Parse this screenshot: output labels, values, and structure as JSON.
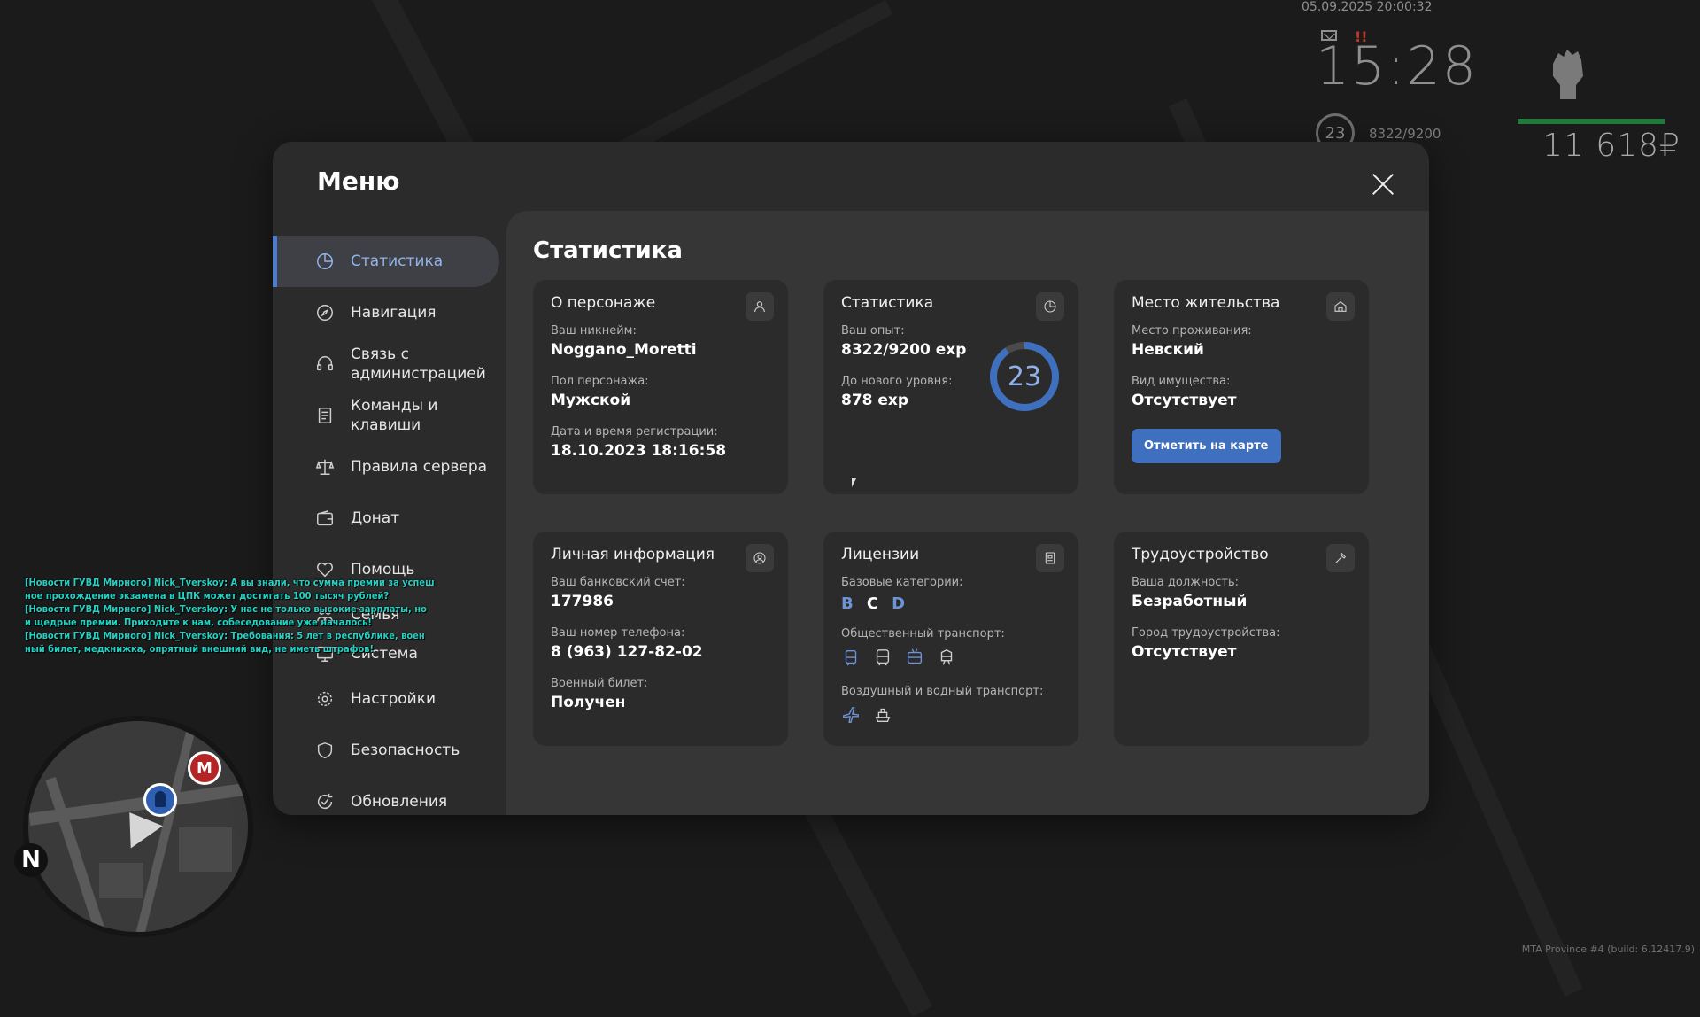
{
  "hud": {
    "datetime": "05.09.2025 20:00:32",
    "clock": "15:28",
    "alert": "!!",
    "level": "23",
    "exp": "8322/9200",
    "money": "11 618₽",
    "build": "MTA Province #4 (build: 6.12417.9)"
  },
  "chat": [
    "[Новости ГУВД Мирного] Nick_Tverskoy: А вы знали, что сумма премии за успеш",
    "ное прохождение экзамена в ЦПК может достигать 100 тысяч рублей?",
    "[Новости ГУВД Мирного] Nick_Tverskoy: У нас не только высокие зарплаты, но",
    " и щедрые премии. Приходите к нам, собеседование уже началось!",
    "[Новости ГУВД Мирного] Nick_Tverskoy: Требования: 5 лет в республике, воен",
    "ный билет, медкнижка, опрятный внешний вид, не иметь штрафов!"
  ],
  "minimap": {
    "north": "N",
    "metro": "М"
  },
  "menu": {
    "title": "Меню",
    "sidebar": [
      {
        "label": "Статистика",
        "icon": "pie-chart-icon",
        "active": true
      },
      {
        "label": "Навигация",
        "icon": "compass-icon"
      },
      {
        "label": "Связь с администрацией",
        "icon": "headset-icon"
      },
      {
        "label": "Команды и клавиши",
        "icon": "document-icon"
      },
      {
        "label": "Правила сервера",
        "icon": "scales-icon"
      },
      {
        "label": "Донат",
        "icon": "wallet-icon"
      },
      {
        "label": "Помощь",
        "icon": "heart-hand-icon"
      },
      {
        "label": "Семья",
        "icon": "family-icon"
      },
      {
        "label": "Система",
        "icon": "system-icon"
      },
      {
        "label": "Настройки",
        "icon": "gear-icon"
      },
      {
        "label": "Безопасность",
        "icon": "shield-icon"
      },
      {
        "label": "Обновления",
        "icon": "refresh-icon"
      }
    ],
    "content_title": "Статистика",
    "cards": {
      "character": {
        "title": "О персонаже",
        "nick_label": "Ваш никнейм:",
        "nick": "Noggano_Moretti",
        "gender_label": "Пол персонажа:",
        "gender": "Мужской",
        "reg_label": "Дата и время регистрации:",
        "reg": "18.10.2023 18:16:58"
      },
      "stats": {
        "title": "Статистика",
        "exp_label": "Ваш опыт:",
        "exp": "8322/9200 exp",
        "next_label": "До нового уровня:",
        "next": "878 exp",
        "level": "23",
        "progress": 0.905
      },
      "residence": {
        "title": "Место жительства",
        "place_label": "Место проживания:",
        "place": "Невский",
        "property_label": "Вид имущества:",
        "property": "Отсутствует",
        "button": "Отметить на карте"
      },
      "personal": {
        "title": "Личная информация",
        "bank_label": "Ваш банковский счет:",
        "bank": "177986",
        "phone_label": "Ваш номер телефона:",
        "phone": "8 (963) 127-82-02",
        "military_label": "Военный билет:",
        "military": "Получен"
      },
      "licenses": {
        "title": "Лицензии",
        "base_label": "Базовые категории:",
        "cat_b": "B",
        "cat_c": "C",
        "cat_d": "D",
        "public_label": "Общественный транспорт:",
        "air_label": "Воздушный и водный транспорт:"
      },
      "job": {
        "title": "Трудоустройство",
        "position_label": "Ваша должность:",
        "position": "Безработный",
        "city_label": "Город трудоустройства:",
        "city": "Отсутствует"
      }
    }
  },
  "colors": {
    "accent": "#4d7bd0",
    "active_text": "#93b4e8",
    "chat": "#22d3c5"
  }
}
